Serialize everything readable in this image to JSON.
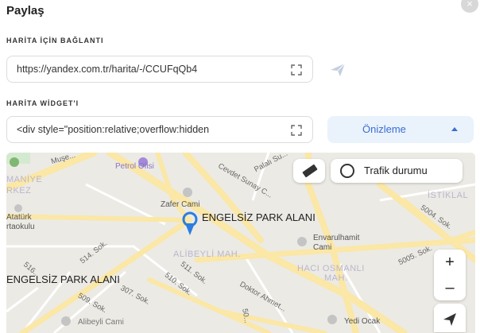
{
  "dialog": {
    "title": "Paylaş",
    "close_glyph": "×",
    "close_icon": "close-icon"
  },
  "link_section": {
    "label": "HARİTA İÇİN BAĞLANTI",
    "value": "https://yandex.com.tr/harita/-/CCUFqQb4",
    "copy_icon": "copy-icon",
    "send_icon": "send-icon"
  },
  "widget_section": {
    "label": "HARİTA WİDGET'I",
    "value": "<div style=\"position:relative;overflow:hidden",
    "copy_icon": "copy-icon",
    "preview_label": "Önizleme",
    "preview_icon": "chevron-up-icon"
  },
  "map": {
    "controls": {
      "ruler_icon": "ruler-icon",
      "traffic_label": "Trafik durumu",
      "traffic_icon": "traffic-icon",
      "zoom_in": "+",
      "zoom_out": "–",
      "locate_icon": "locate-icon"
    },
    "labels": {
      "selected_place": "ENGELSİZ PARK ALANI",
      "second_place": "ENGELSİZ PARK ALANI",
      "zafer_cami": "Zafer Cami",
      "petrol_ofisi": "Petrol Ofisi",
      "envarulhamit": "Envarulhamit",
      "cami": "Cami",
      "yedi_ocak": "Yedi Ocak",
      "alibeyli": "ALİBEYLİ MAH.",
      "haci_osmanli": "HACI OSMANLI",
      "mah": "MAH.",
      "istiklal": "İSTİKLAL",
      "maniye": "MANİYE",
      "rkez": "RKEZ",
      "ataturk": "Atatürk",
      "rtaokulu": "rtaokulu",
      "cevdet_sunay": "Cevdet Sunay C...",
      "palali": "Palalı Su...",
      "muse": "Muşe...",
      "sok_5004": "5004. Sok.",
      "sok_5005": "5005. Sok.",
      "sok_514": "514. Sok.",
      "sok_511": "511. Sok.",
      "sok_510": "510. Sok.",
      "sok_509": "509. Sok.",
      "sok_307": "307. Sok.",
      "sok_516": "516...",
      "doktor_ahmet": "Doktor Ahmet...",
      "sok_50": "50...",
      "alibeyli_cami": "Alibeyli Cami"
    },
    "colors": {
      "land": "#eceae4",
      "road_major": "#fbe7a6",
      "road_minor": "#ffffff",
      "park": "#d4ead0",
      "pin": "#2b7de0"
    }
  }
}
